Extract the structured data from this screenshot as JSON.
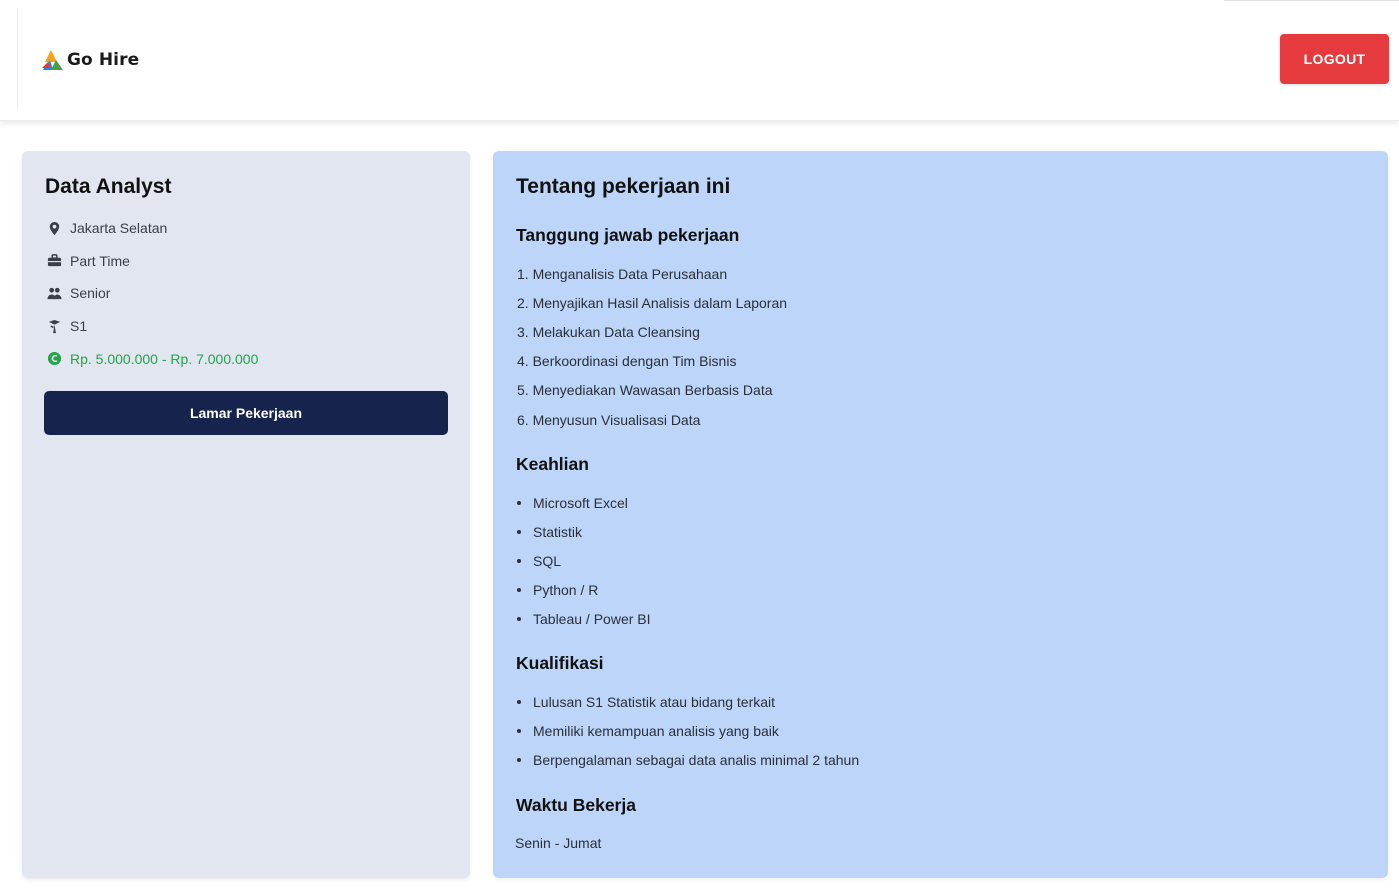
{
  "header": {
    "brand_name": "Go Hire",
    "logout_label": "LOGOUT"
  },
  "job": {
    "title": "Data Analyst",
    "meta": [
      {
        "icon": "location-pin-icon",
        "text": "Jakarta Selatan"
      },
      {
        "icon": "briefcase-icon",
        "text": "Part Time"
      },
      {
        "icon": "users-icon",
        "text": "Senior"
      },
      {
        "icon": "education-icon",
        "text": "S1"
      },
      {
        "icon": "money-icon",
        "text": "Rp. 5.000.000 - Rp. 7.000.000"
      }
    ],
    "apply_label": "Lamar Pekerjaan"
  },
  "about": {
    "title": "Tentang pekerjaan ini",
    "responsibilities_heading": "Tanggung jawab pekerjaan",
    "responsibilities": [
      "1. Menganalisis Data Perusahaan",
      "2. Menyajikan Hasil Analisis dalam Laporan",
      "3. Melakukan Data Cleansing",
      "4. Berkoordinasi dengan Tim Bisnis",
      "5. Menyediakan Wawasan Berbasis Data",
      "6. Menyusun Visualisasi Data"
    ],
    "skills_heading": "Keahlian",
    "skills": [
      "Microsoft Excel",
      "Statistik",
      "SQL",
      "Python / R",
      "Tableau / Power BI"
    ],
    "qualifications_heading": "Kualifikasi",
    "qualifications": [
      "Lulusan S1 Statistik atau bidang terkait",
      "Memiliki kemampuan analisis yang baik",
      "Berpengalaman sebagai data analis minimal 2 tahun"
    ],
    "hours_heading": "Waktu Bekerja",
    "hours": "Senin - Jumat"
  },
  "colors": {
    "logout": "#e63b3e",
    "apply": "#16234d",
    "left_card": "#e1e6f0",
    "right_card": "#bcd5f8",
    "salary": "#22a447"
  }
}
